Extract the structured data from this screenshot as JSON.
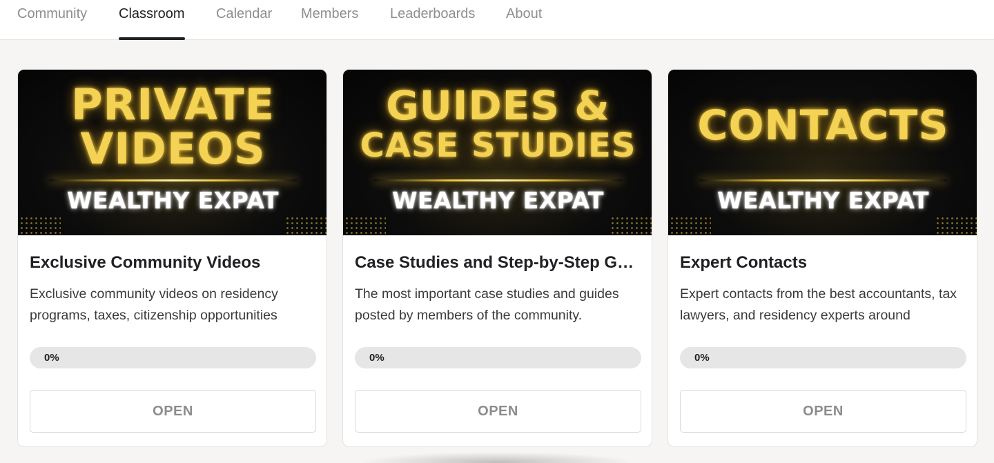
{
  "nav": {
    "tabs": [
      {
        "label": "Community",
        "active": false
      },
      {
        "label": "Classroom",
        "active": true
      },
      {
        "label": "Calendar",
        "active": false
      },
      {
        "label": "Members",
        "active": false
      },
      {
        "label": "Leaderboards",
        "active": false
      },
      {
        "label": "About",
        "active": false
      }
    ]
  },
  "courses": [
    {
      "thumbnail": {
        "line1": "PRIVATE",
        "line2": "VIDEOS",
        "brand": "WEALTHY EXPAT"
      },
      "title": "Exclusive Community Videos",
      "description": "Exclusive community videos on residency programs, taxes, citizenship opportunities",
      "progress_label": "0%",
      "progress_value": 0,
      "button_label": "OPEN"
    },
    {
      "thumbnail": {
        "line1": "GUIDES &",
        "line2": "CASE STUDIES",
        "brand": "WEALTHY EXPAT"
      },
      "title": "Case Studies and Step-by-Step Guides",
      "description": "The most important case studies and guides posted by members of the community.",
      "progress_label": "0%",
      "progress_value": 0,
      "button_label": "OPEN"
    },
    {
      "thumbnail": {
        "line1": "CONTACTS",
        "brand": "WEALTHY EXPAT"
      },
      "title": "Expert Contacts",
      "description": "Expert contacts from the best accountants, tax lawyers, and residency experts around",
      "progress_label": "0%",
      "progress_value": 0,
      "button_label": "OPEN"
    }
  ],
  "colors": {
    "accent_gold": "#f4d253",
    "active_tab": "#202124",
    "inactive_tab": "#8e8e8e",
    "progress_track": "#e6e6e6"
  }
}
